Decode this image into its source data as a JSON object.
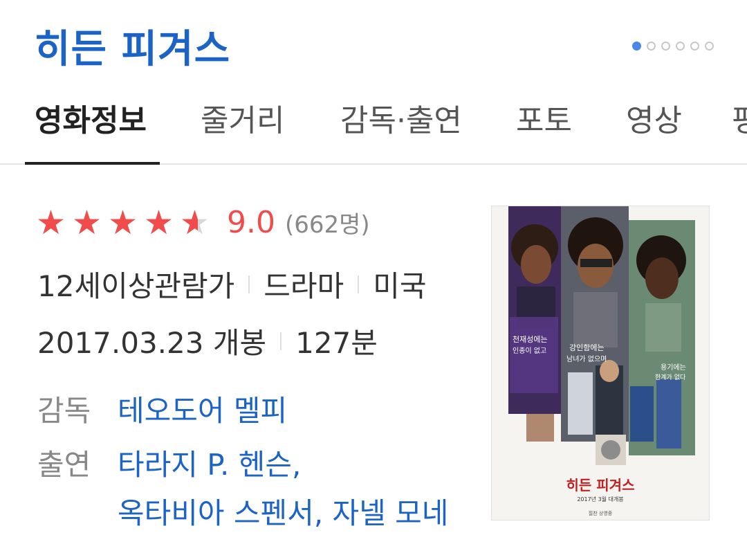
{
  "movie_title": "히든 피겨스",
  "carousel": {
    "total": 6,
    "active": 0
  },
  "tabs": [
    "영화정보",
    "줄거리",
    "감독·출연",
    "포토",
    "영상",
    "평"
  ],
  "rating": {
    "score_value": 4.5,
    "max": 5,
    "score_label": "9.0",
    "count": "(662명)"
  },
  "info": {
    "age": "12세이상관람가",
    "genre": "드라마",
    "country": "미국",
    "release": "2017.03.23 개봉",
    "runtime": "127분"
  },
  "director": {
    "label": "감독",
    "name": "테오도어 멜피"
  },
  "cast": {
    "label": "출연",
    "line1": "타라지 P. 헨슨,",
    "line2": "옥타비아 스펜서, 자넬 모네"
  },
  "poster": {
    "title": "히든 피겨스",
    "date": "2017년 3월 대개봉",
    "caption1_a": "천재성에는",
    "caption1_b": "인종이 없고",
    "caption2_a": "강인함에는",
    "caption2_b": "남녀가 없으며",
    "caption3_a": "용기에는",
    "caption3_b": "한계가 없다",
    "footer": "절찬 상영중"
  },
  "colors": {
    "accent": "#1b63c5",
    "star": "#f24b4b"
  }
}
